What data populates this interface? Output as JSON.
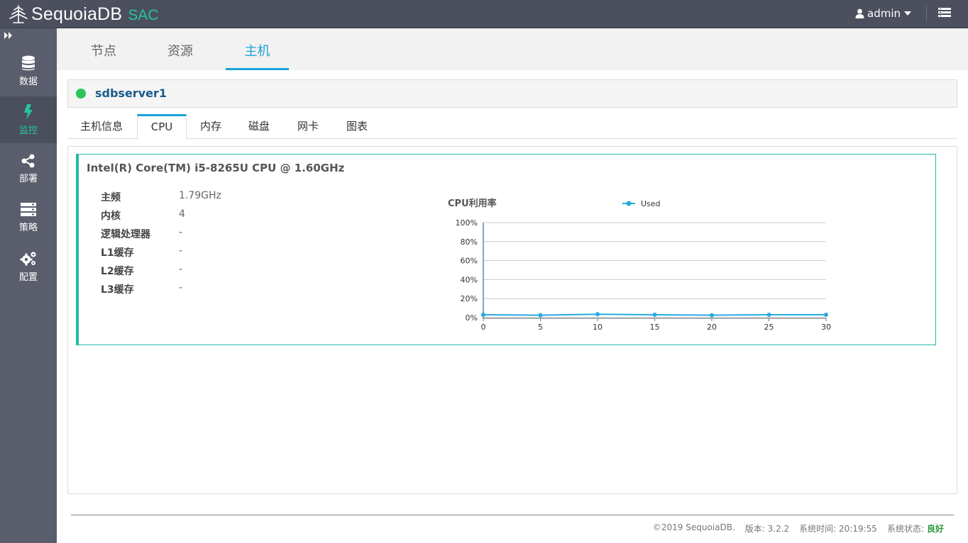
{
  "brand": {
    "name": "SequoiaDB",
    "product": "SAC"
  },
  "topbar": {
    "user": "admin"
  },
  "sidebar": {
    "items": [
      {
        "label": "数据",
        "icon": "database-icon"
      },
      {
        "label": "监控",
        "icon": "bolt-icon"
      },
      {
        "label": "部署",
        "icon": "share-icon"
      },
      {
        "label": "策略",
        "icon": "server-icon"
      },
      {
        "label": "配置",
        "icon": "gears-icon"
      }
    ],
    "active": 1
  },
  "main_tabs": [
    {
      "label": "节点"
    },
    {
      "label": "资源"
    },
    {
      "label": "主机"
    }
  ],
  "host": {
    "name": "sdbserver1",
    "status_color": "#2ac45c"
  },
  "sub_tabs": [
    {
      "label": "主机信息"
    },
    {
      "label": "CPU"
    },
    {
      "label": "内存"
    },
    {
      "label": "磁盘"
    },
    {
      "label": "网卡"
    },
    {
      "label": "图表"
    }
  ],
  "cpu": {
    "model": "Intel(R) Core(TM) i5-8265U CPU @ 1.60GHz",
    "info": [
      {
        "label": "主频",
        "value": "1.79GHz"
      },
      {
        "label": "内核",
        "value": "4"
      },
      {
        "label": "逻辑处理器",
        "value": "-"
      },
      {
        "label": "L1缓存",
        "value": "-"
      },
      {
        "label": "L2缓存",
        "value": "-"
      },
      {
        "label": "L3缓存",
        "value": "-"
      }
    ]
  },
  "chart_data": {
    "type": "line",
    "title": "CPU利用率",
    "legend": "top-right",
    "x": [
      0,
      5,
      10,
      15,
      20,
      25,
      30
    ],
    "series": [
      {
        "name": "Used",
        "values": [
          3,
          2.5,
          3.5,
          3,
          2.5,
          3,
          3
        ],
        "color": "#29abe0"
      }
    ],
    "xlim": [
      0,
      30
    ],
    "ylim": [
      0,
      100
    ],
    "y_ticks": [
      "0%",
      "20%",
      "40%",
      "60%",
      "80%",
      "100%"
    ],
    "x_ticks": [
      "0",
      "5",
      "10",
      "15",
      "20",
      "25",
      "30"
    ],
    "grid": true
  },
  "footer": {
    "copyright": "©2019 SequoiaDB.",
    "version": "版本: 3.2.2",
    "time": "系统时间: 20:19:55",
    "status_label": "系统状态:",
    "status_value": "良好"
  }
}
